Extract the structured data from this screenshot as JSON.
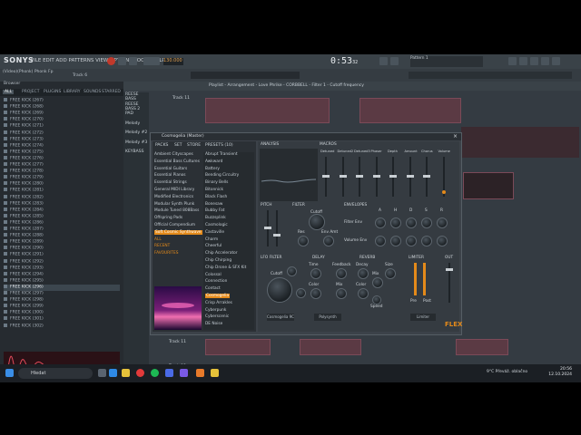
{
  "app": {
    "title": "SONYS",
    "menu": "FILE EDIT ADD PATTERNS VIEW OPTIONS TOOLS HELP",
    "project_name": "(Video)(Phonk) Phonk Fp",
    "cpu_ram": "Track 6"
  },
  "transport": {
    "time": "0:53",
    "time_sub": "32",
    "bpm": "130.000",
    "pattern": "Pattern 1"
  },
  "hint": {
    "text": "Playlist - Arrangement - Love Phrike - CORBBELL - Filter 1 - Cutoff frequency"
  },
  "browser": {
    "title": "Browser",
    "tabs": [
      "ALL",
      "PROJECT",
      "PLUGINS",
      "LIBRARY",
      "SOUNDS",
      "STARRED"
    ],
    "items": [
      "FREE KICK (267)",
      "FREE KICK (268)",
      "FREE KICK (269)",
      "FREE KICK (270)",
      "FREE KICK (271)",
      "FREE KICK (272)",
      "FREE KICK (273)",
      "FREE KICK (274)",
      "FREE KICK (275)",
      "FREE KICK (276)",
      "FREE KICK (277)",
      "FREE KICK (278)",
      "FREE KICK (279)",
      "FREE KICK (280)",
      "FREE KICK (281)",
      "FREE KICK (282)",
      "FREE KICK (283)",
      "FREE KICK (284)",
      "FREE KICK (285)",
      "FREE KICK (286)",
      "FREE KICK (287)",
      "FREE KICK (288)",
      "FREE KICK (289)",
      "FREE KICK (290)",
      "FREE KICK (291)",
      "FREE KICK (292)",
      "FREE KICK (293)",
      "FREE KICK (294)",
      "FREE KICK (295)",
      "FREE KICK (296)",
      "FREE KICK (297)",
      "FREE KICK (298)",
      "FREE KICK (299)",
      "FREE KICK (300)",
      "FREE KICK (301)",
      "FREE KICK (302)"
    ],
    "selected_index": 29
  },
  "arrangement": {
    "tracks": [
      "REESE BASS",
      "REESE BASS 2",
      "PAD",
      "Melody",
      "Melody #2",
      "Melody #3",
      "KEYBASS"
    ],
    "track_bottom": [
      "Track 11",
      "Track 12"
    ]
  },
  "plugin": {
    "title": "Cosmogelia (Master)",
    "tabs": [
      "PACKS",
      "SET",
      "STORE"
    ],
    "presets_header": "PRESETS (10)",
    "packs": [
      "Ambient Cityscapes",
      "Essential Bass Cultures",
      "Essential Guitars",
      "Essential Pianos",
      "Essential Strings",
      "General MIDI Library",
      "Modified Electronics",
      "Modular Synth Plunk",
      "Module Tuned 808Bass",
      "Offspring Pads",
      "Official Compendium"
    ],
    "pack_selected": "Soft Cosmic Synthwave",
    "pack_extra": [
      "ALL",
      "RECENT",
      "FAVOURITES"
    ],
    "presets": [
      "Abrupt Transient",
      "Awkward",
      "Battery",
      "Bending Circuitry",
      "Binary Bells",
      "Bitonnick",
      "Black Flash",
      "Bonesaw",
      "Bubby Fat",
      "Buzzsplink",
      "Casmologic",
      "Castaville",
      "Charm",
      "Cheerful",
      "Chip Accelerator",
      "Chip Chirping",
      "Chip Drone & SFX Kit",
      "Colossal",
      "Connection",
      "Contact",
      "Cosmogelia",
      "Crisp Arrakles",
      "Cyberpunk",
      "Cyberscenic",
      "DE Noise"
    ],
    "preset_selected_index": 20,
    "sections": {
      "analysis": "ANALYSIS",
      "macros": "MACROS",
      "macro_labels": [
        "Detuned",
        "Detuned2",
        "Detuned3",
        "Phaser",
        "Depth",
        "Amount",
        "Chorus",
        "Volume"
      ],
      "pitch": "PITCH",
      "filter": "FILTER",
      "filter_knobs": [
        "Cutoff",
        "Res",
        "Env Amt"
      ],
      "envelopes": "ENVELOPES",
      "env_rows": [
        "Filter Env",
        "Volume Env"
      ],
      "env_cols": [
        "A",
        "H",
        "D",
        "S",
        "R"
      ],
      "lfo": "LFO FILTER",
      "delay": "DELAY",
      "delay_knobs": [
        "Time",
        "Feedback",
        "Color",
        "Mix"
      ],
      "reverb": "REVERB",
      "reverb_knobs": [
        "Decay",
        "Size",
        "Color",
        "Mix",
        "Speed"
      ],
      "limiter": "LIMITER",
      "limiter_knobs": [
        "Pre",
        "Post"
      ],
      "out": "OUT",
      "cutoff": "Cutoff",
      "brand": "FLEX",
      "bottom_left": "Cosmogelia 9C",
      "bottom_mid": "Polysynth",
      "bottom_right": "Limiter"
    }
  },
  "taskbar": {
    "search": "Hledat",
    "weather": "9°C  Převáž. oblačno",
    "time": "20:56",
    "date": "12.10.2024"
  },
  "colors": {
    "accent": "#e48a1a",
    "pattern": "#5b3a44"
  }
}
